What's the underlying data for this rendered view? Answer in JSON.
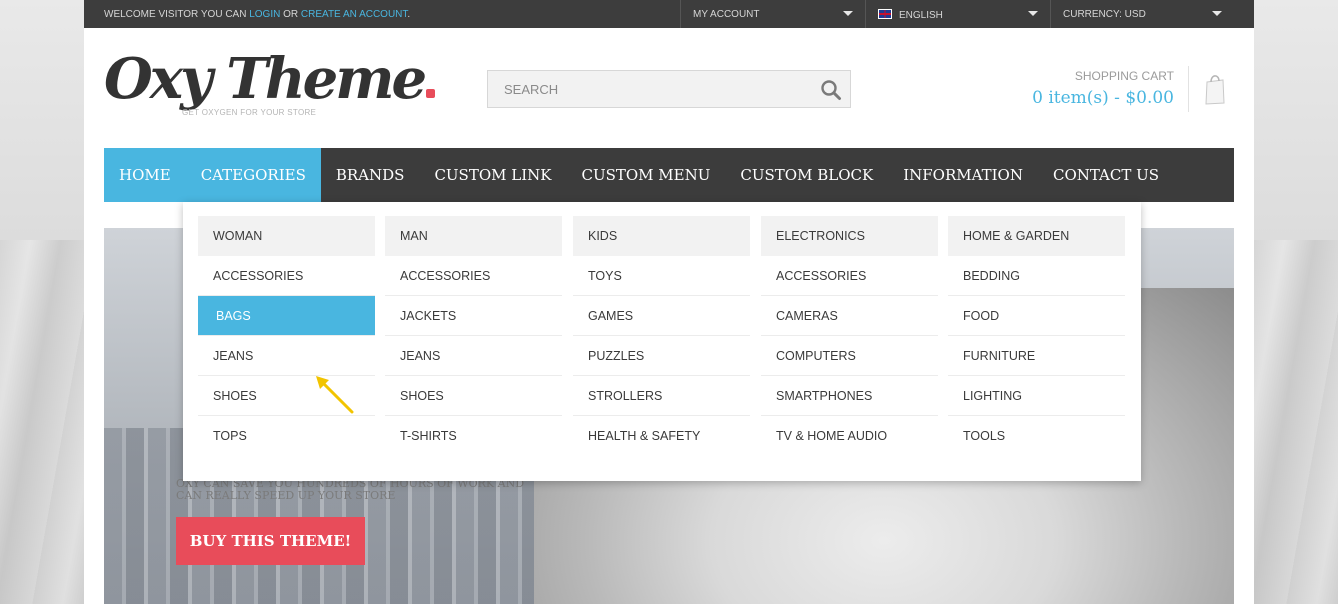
{
  "topbar": {
    "welcome_prefix": "WELCOME VISITOR YOU CAN",
    "login": "LOGIN",
    "or": "OR",
    "create_account": "CREATE AN ACCOUNT",
    "create_suffix": ".",
    "my_account": "MY ACCOUNT",
    "language": "ENGLISH",
    "currency": "CURRENCY: USD"
  },
  "header": {
    "logo_text": "Oxy Theme",
    "tagline": "GET OXYGEN FOR YOUR STORE",
    "search_placeholder": "SEARCH",
    "cart_label": "SHOPPING CART",
    "cart_total": "0 item(s) - $0.00"
  },
  "nav": {
    "items": [
      "HOME",
      "CATEGORIES",
      "BRANDS",
      "CUSTOM LINK",
      "CUSTOM MENU",
      "CUSTOM BLOCK",
      "INFORMATION",
      "CONTACT US"
    ]
  },
  "mega_menu": {
    "columns": [
      {
        "head": "WOMAN",
        "items": [
          "ACCESSORIES",
          "BAGS",
          "JEANS",
          "SHOES",
          "TOPS"
        ]
      },
      {
        "head": "MAN",
        "items": [
          "ACCESSORIES",
          "JACKETS",
          "JEANS",
          "SHOES",
          "T-SHIRTS"
        ]
      },
      {
        "head": "KIDS",
        "items": [
          "TOYS",
          "GAMES",
          "PUZZLES",
          "STROLLERS",
          "HEALTH & SAFETY"
        ]
      },
      {
        "head": "ELECTRONICS",
        "items": [
          "ACCESSORIES",
          "CAMERAS",
          "COMPUTERS",
          "SMARTPHONES",
          "TV & HOME AUDIO"
        ]
      },
      {
        "head": "HOME & GARDEN",
        "items": [
          "BEDDING",
          "FOOD",
          "FURNITURE",
          "LIGHTING",
          "TOOLS"
        ]
      }
    ],
    "highlighted_item": "BAGS"
  },
  "hero": {
    "tagline": "OXY CAN SAVE YOU HUNDREDS OF HOURS OF WORK AND CAN REALLY SPEED UP YOUR STORE",
    "button": "BUY THIS THEME!"
  },
  "colors": {
    "accent": "#49b6e0",
    "topbar": "#3d3d3d",
    "nav": "#3c3c3c",
    "button": "#e84c5a"
  }
}
